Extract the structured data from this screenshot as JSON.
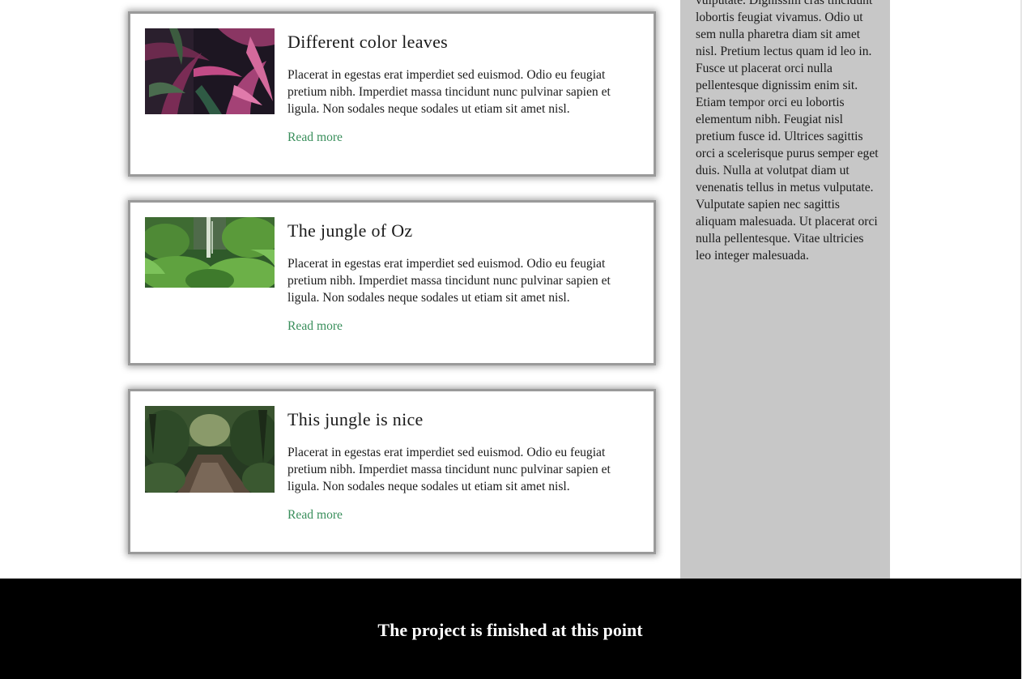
{
  "posts": [
    {
      "title": "Different color leaves",
      "text": "Placerat in egestas erat imperdiet sed euismod. Odio eu feugiat pretium nibh. Imperdiet massa tincidunt nunc pulvinar sapien et ligula. Non sodales neque sodales ut etiam sit amet nisl.",
      "link": "Read more",
      "image": "purple-jungle-leaves-photo"
    },
    {
      "title": "The jungle of Oz",
      "text": "Placerat in egestas erat imperdiet sed euismod. Odio eu feugiat pretium nibh. Imperdiet massa tincidunt nunc pulvinar sapien et ligula. Non sodales neque sodales ut etiam sit amet nisl.",
      "link": "Read more",
      "image": "jungle-waterfall-photo"
    },
    {
      "title": "This jungle is nice",
      "text": "Placerat in egestas erat imperdiet sed euismod. Odio eu feugiat pretium nibh. Imperdiet massa tincidunt nunc pulvinar sapien et ligula. Non sodales neque sodales ut etiam sit amet nisl.",
      "link": "Read more",
      "image": "jungle-path-photo"
    }
  ],
  "sidebar": {
    "text": "vulputate. Dignissim cras tincidunt lobortis feugiat vivamus. Odio ut sem nulla pharetra diam sit amet nisl. Pretium lectus quam id leo in. Fusce ut placerat orci nulla pellentesque dignissim enim sit. Etiam tempor orci eu lobortis elementum nibh. Feugiat nisl pretium fusce id. Ultrices sagittis orci a scelerisque purus semper eget duis. Nulla at volutpat diam ut venenatis tellus in metus vulputate. Vulputate sapien nec sagittis aliquam malesuada. Ut placerat orci nulla pellentesque. Vitae ultricies leo integer malesuada."
  },
  "footer": {
    "text": "The project is finished at this point"
  },
  "colors": {
    "link": "#3a8f5c",
    "sidebar_bg": "#c7c7c7",
    "footer_bg": "#000000",
    "card_border": "#9a9a9a"
  }
}
